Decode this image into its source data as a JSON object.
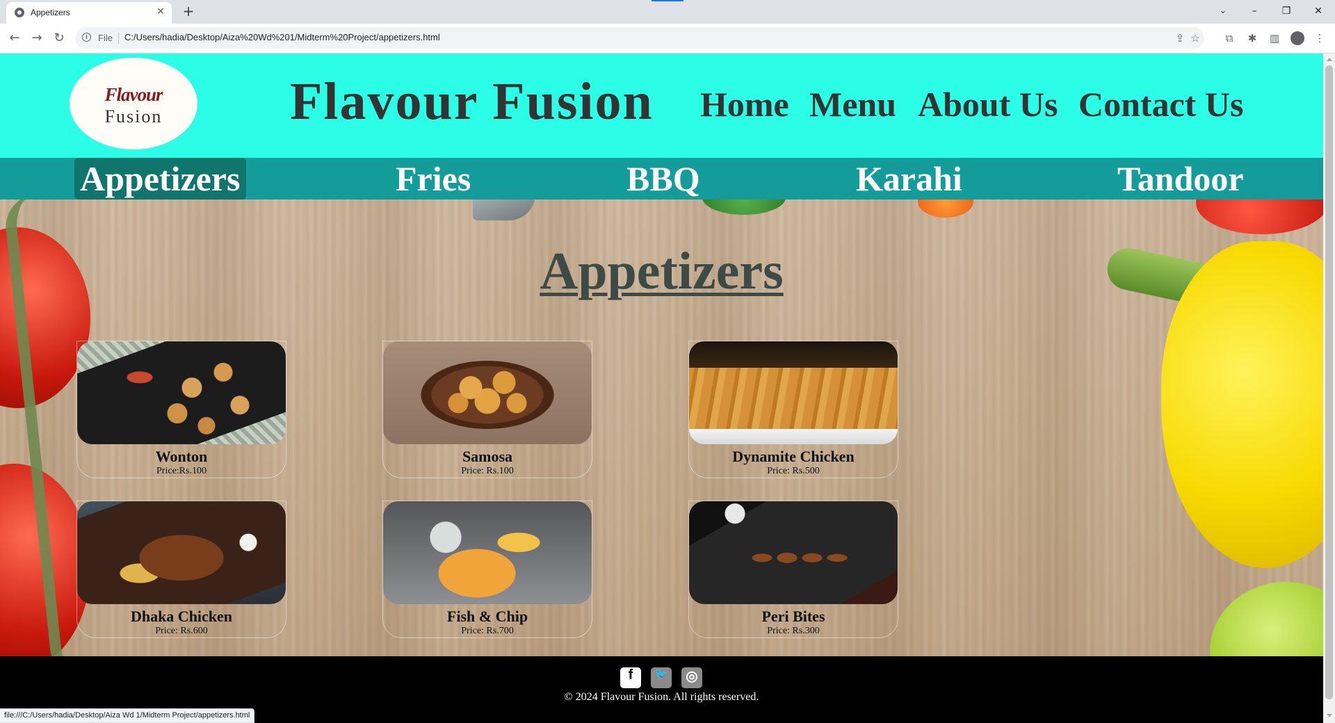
{
  "browser": {
    "tab_title": "Appetizers",
    "tab_close": "✕",
    "new_tab": "+",
    "url_scheme": "File",
    "url": "C:/Users/hadia/Desktop/Aiza%20Wd%201/Midterm%20Project/appetizers.html",
    "status_url": "file:///C:/Users/hadia/Desktop/Aiza Wd 1/Midterm Project/appetizers.html",
    "controls": {
      "tab_search": "⌄",
      "minimize": "–",
      "restore": "❐",
      "close": "✕",
      "back": "←",
      "forward": "→",
      "reload": "↻",
      "share": "⇪",
      "bookmark": "☆",
      "extension": "⧉",
      "puzzle": "✱",
      "sidepanel": "▥",
      "menu": "⋮"
    }
  },
  "header": {
    "logo_top": "Flavour",
    "logo_bottom": "Fusion",
    "site_title": "Flavour Fusion",
    "nav": [
      "Home",
      "Menu",
      "About Us",
      "Contact Us"
    ]
  },
  "categories": {
    "items": [
      "Appetizers",
      "Fries",
      "BBQ",
      "Karahi",
      "Tandoor"
    ],
    "active": "Appetizers"
  },
  "page": {
    "heading": "Appetizers",
    "items": [
      {
        "name": "Wonton",
        "price": "Price:Rs.100"
      },
      {
        "name": "Samosa",
        "price": "Price: Rs.100"
      },
      {
        "name": "Dynamite Chicken",
        "price": "Price: Rs.500"
      },
      {
        "name": "Dhaka Chicken",
        "price": "Price: Rs.600"
      },
      {
        "name": "Fish & Chip",
        "price": "Price: Rs.700"
      },
      {
        "name": "Peri Bites",
        "price": "Price: Rs.300"
      }
    ]
  },
  "footer": {
    "social": [
      {
        "icon": "facebook-icon",
        "glyph": "f"
      },
      {
        "icon": "twitter-icon",
        "glyph": "🐦"
      },
      {
        "icon": "instagram-icon",
        "glyph": "◎"
      }
    ],
    "copyright": "© 2024 Flavour Fusion. All rights reserved."
  },
  "colors": {
    "header_bg": "#2cfde7",
    "category_bar": "#149c9a",
    "active_category": "#0f756d",
    "footer_bg": "#000000"
  }
}
